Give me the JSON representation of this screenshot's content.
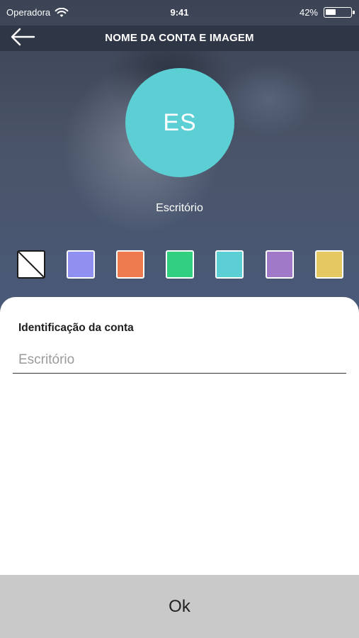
{
  "status_bar": {
    "carrier": "Operadora",
    "time": "9:41",
    "battery_text": "42%",
    "battery_level": 0.42
  },
  "header": {
    "title": "NOME DA CONTA E IMAGEM"
  },
  "avatar": {
    "initials": "ES",
    "name": "Escritório",
    "color": "#5ccfd4"
  },
  "swatches": [
    {
      "name": "none",
      "color": "#ffffff"
    },
    {
      "name": "periwinkle",
      "color": "#9090f0"
    },
    {
      "name": "orange",
      "color": "#ee7a50"
    },
    {
      "name": "green",
      "color": "#30d080"
    },
    {
      "name": "cyan",
      "color": "#5ccfd4"
    },
    {
      "name": "purple",
      "color": "#a07ac8"
    },
    {
      "name": "yellow",
      "color": "#e6c862"
    }
  ],
  "form": {
    "label": "Identificação da conta",
    "placeholder": "Escritório",
    "value": ""
  },
  "footer": {
    "ok_label": "Ok"
  }
}
